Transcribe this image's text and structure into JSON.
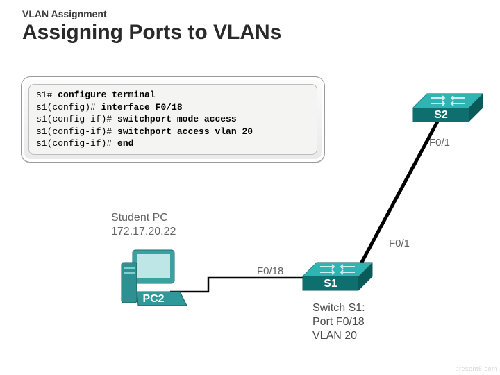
{
  "section_subtitle": "VLAN Assignment",
  "title": "Assigning Ports to VLANs",
  "watermark": "present5.com",
  "terminal": {
    "lines": [
      {
        "prompt": "s1#",
        "cmd": "configure terminal",
        "bold": true
      },
      {
        "prompt": "s1(config)#",
        "cmd": "interface F0/18",
        "bold": true
      },
      {
        "prompt": "s1(config-if)#",
        "cmd": "switchport mode access",
        "bold": true
      },
      {
        "prompt": "s1(config-if)#",
        "cmd": "switchport access vlan 20",
        "bold": true
      },
      {
        "prompt": "s1(config-if)#",
        "cmd": "end",
        "bold": true
      }
    ]
  },
  "devices": {
    "pc": {
      "name": "PC2",
      "caption_name": "Student PC",
      "ip": "172.17.20.22"
    },
    "s1": {
      "name": "S1",
      "caption": [
        "Switch S1:",
        "Port F0/18",
        "VLAN 20"
      ]
    },
    "s2": {
      "name": "S2"
    }
  },
  "links": {
    "pc_s1_port": "F0/18",
    "s1_s2_port_s1": "F0/1",
    "s1_s2_port_s2": "F0/1"
  }
}
